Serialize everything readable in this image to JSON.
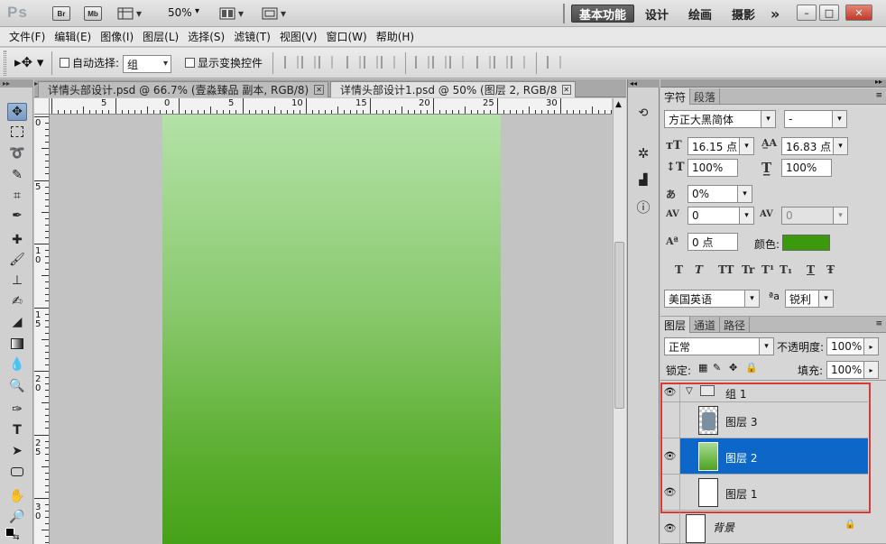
{
  "app": {
    "logo": "Ps",
    "bridge_label": "Br",
    "minibridge_label": "Mb",
    "zoom": "50%",
    "workspaces": [
      "基本功能",
      "设计",
      "绘画",
      "摄影"
    ],
    "more": "»",
    "window_buttons": [
      "–",
      "□",
      "✕"
    ]
  },
  "menu": [
    "文件(F)",
    "编辑(E)",
    "图像(I)",
    "图层(L)",
    "选择(S)",
    "滤镜(T)",
    "视图(V)",
    "窗口(W)",
    "帮助(H)"
  ],
  "options": {
    "auto_select_label": "自动选择:",
    "auto_select_value": "组",
    "show_transform_label": "显示变换控件"
  },
  "tabs": [
    {
      "label": "详情头部设计.psd @ 66.7% (壹淼臻品 副本, RGB/8) *",
      "active": false
    },
    {
      "label": "详情头部设计1.psd @ 50% (图层 2, RGB/8) *",
      "active": true
    }
  ],
  "ruler_top": [
    "5",
    "0",
    "5",
    "10",
    "15",
    "20",
    "25",
    "30"
  ],
  "ruler_left": [
    "0",
    "5",
    "1\n0",
    "1\n5",
    "2\n0",
    "2\n5",
    "3\n0"
  ],
  "character": {
    "tabs": [
      "字符",
      "段落"
    ],
    "font_family": "方正大黑简体",
    "font_style": "-",
    "font_size": "16.15 点",
    "leading": "16.83 点",
    "vertical_scale": "100%",
    "horizontal_scale": "100%",
    "tsume": "0%",
    "kerning": "0",
    "tracking": "0",
    "baseline_shift": "0 点",
    "color_label": "颜色:",
    "color": "#3b9a0c",
    "language": "美国英语",
    "aa_prefix": "a",
    "antialias": "锐利",
    "style_buttons": [
      "T",
      "T",
      "TT",
      "Tr",
      "T¹",
      "T₁",
      "T",
      "Ŧ"
    ]
  },
  "layers": {
    "tabs": [
      "图层",
      "通道",
      "路径"
    ],
    "blend_mode": "正常",
    "opacity_label": "不透明度:",
    "opacity": "100%",
    "lock_label": "锁定:",
    "fill_label": "填充:",
    "fill": "100%",
    "items": [
      {
        "name": "组 1",
        "type": "group",
        "visible": true
      },
      {
        "name": "图层 3",
        "type": "image",
        "visible": false
      },
      {
        "name": "图层 2",
        "type": "gradient",
        "visible": true,
        "selected": true
      },
      {
        "name": "图层 1",
        "type": "blank",
        "visible": true
      },
      {
        "name": "背景",
        "type": "background",
        "visible": true
      }
    ]
  }
}
